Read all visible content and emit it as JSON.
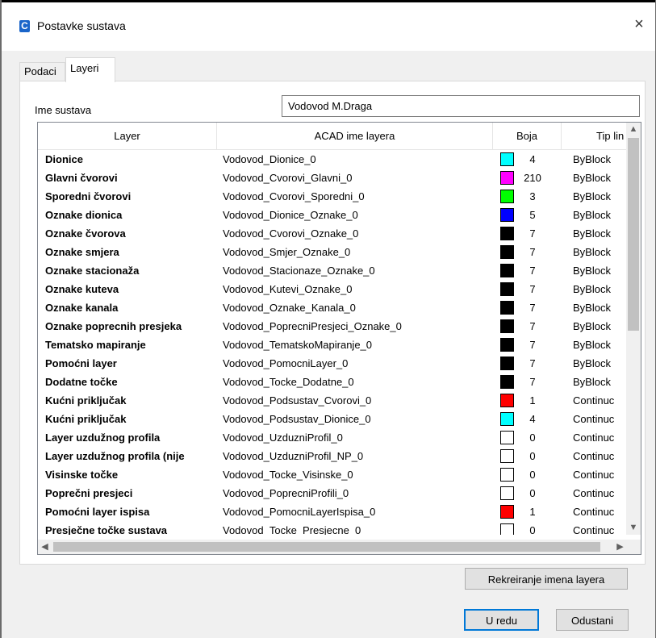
{
  "window": {
    "title": "Postavke sustava",
    "icon_letter": "C",
    "close_glyph": "×"
  },
  "tabs": [
    {
      "label": "Podaci"
    },
    {
      "label": "Layeri"
    }
  ],
  "form": {
    "ime_label": "Ime sustava",
    "ime_value": "Vodovod M.Draga"
  },
  "grid": {
    "columns": [
      "Layer",
      "ACAD ime layera",
      "Boja",
      "Tip lin"
    ],
    "rows": [
      {
        "layer": "Dionice",
        "acad": "Vodovod_Dionice_0",
        "color": "#00ffff",
        "boja": "4",
        "tip": "ByBlock"
      },
      {
        "layer": "Glavni čvorovi",
        "acad": "Vodovod_Cvorovi_Glavni_0",
        "color": "#ff00ff",
        "boja": "210",
        "tip": "ByBlock"
      },
      {
        "layer": "Sporedni čvorovi",
        "acad": "Vodovod_Cvorovi_Sporedni_0",
        "color": "#00ff00",
        "boja": "3",
        "tip": "ByBlock"
      },
      {
        "layer": "Oznake dionica",
        "acad": "Vodovod_Dionice_Oznake_0",
        "color": "#0000ff",
        "boja": "5",
        "tip": "ByBlock"
      },
      {
        "layer": "Oznake čvorova",
        "acad": "Vodovod_Cvorovi_Oznake_0",
        "color": "#000000",
        "boja": "7",
        "tip": "ByBlock"
      },
      {
        "layer": "Oznake smjera",
        "acad": "Vodovod_Smjer_Oznake_0",
        "color": "#000000",
        "boja": "7",
        "tip": "ByBlock"
      },
      {
        "layer": "Oznake stacionaža",
        "acad": "Vodovod_Stacionaze_Oznake_0",
        "color": "#000000",
        "boja": "7",
        "tip": "ByBlock"
      },
      {
        "layer": "Oznake kuteva",
        "acad": "Vodovod_Kutevi_Oznake_0",
        "color": "#000000",
        "boja": "7",
        "tip": "ByBlock"
      },
      {
        "layer": "Oznake kanala",
        "acad": "Vodovod_Oznake_Kanala_0",
        "color": "#000000",
        "boja": "7",
        "tip": "ByBlock"
      },
      {
        "layer": "Oznake poprecnih presjeka",
        "acad": "Vodovod_PoprecniPresjeci_Oznake_0",
        "color": "#000000",
        "boja": "7",
        "tip": "ByBlock"
      },
      {
        "layer": "Tematsko mapiranje",
        "acad": "Vodovod_TematskoMapiranje_0",
        "color": "#000000",
        "boja": "7",
        "tip": "ByBlock"
      },
      {
        "layer": "Pomoćni layer",
        "acad": "Vodovod_PomocniLayer_0",
        "color": "#000000",
        "boja": "7",
        "tip": "ByBlock"
      },
      {
        "layer": "Dodatne točke",
        "acad": "Vodovod_Tocke_Dodatne_0",
        "color": "#000000",
        "boja": "7",
        "tip": "ByBlock"
      },
      {
        "layer": "Kućni priključak",
        "acad": "Vodovod_Podsustav_Cvorovi_0",
        "color": "#ff0000",
        "boja": "1",
        "tip": "Continuc"
      },
      {
        "layer": "Kućni priključak",
        "acad": "Vodovod_Podsustav_Dionice_0",
        "color": "#00ffff",
        "boja": "4",
        "tip": "Continuc"
      },
      {
        "layer": "Layer uzdužnog profila",
        "acad": "Vodovod_UzduzniProfil_0",
        "color": "#ffffff",
        "boja": "0",
        "tip": "Continuc"
      },
      {
        "layer": "Layer uzdužnog profila (nije",
        "acad": "Vodovod_UzduzniProfil_NP_0",
        "color": "#ffffff",
        "boja": "0",
        "tip": "Continuc"
      },
      {
        "layer": "Visinske točke",
        "acad": "Vodovod_Tocke_Visinske_0",
        "color": "#ffffff",
        "boja": "0",
        "tip": "Continuc"
      },
      {
        "layer": "Poprečni presjeci",
        "acad": "Vodovod_PoprecniProfili_0",
        "color": "#ffffff",
        "boja": "0",
        "tip": "Continuc"
      },
      {
        "layer": "Pomoćni layer ispisa",
        "acad": "Vodovod_PomocniLayerIspisa_0",
        "color": "#ff0000",
        "boja": "1",
        "tip": "Continuc"
      },
      {
        "layer": "Presječne točke sustava",
        "acad": "Vodovod_Tocke_Presjecne_0",
        "color": "#ffffff",
        "boja": "0",
        "tip": "Continuc"
      }
    ]
  },
  "buttons": {
    "rekreiranje": "Rekreiranje imena layera",
    "uredu": "U redu",
    "odustani": "Odustani"
  }
}
